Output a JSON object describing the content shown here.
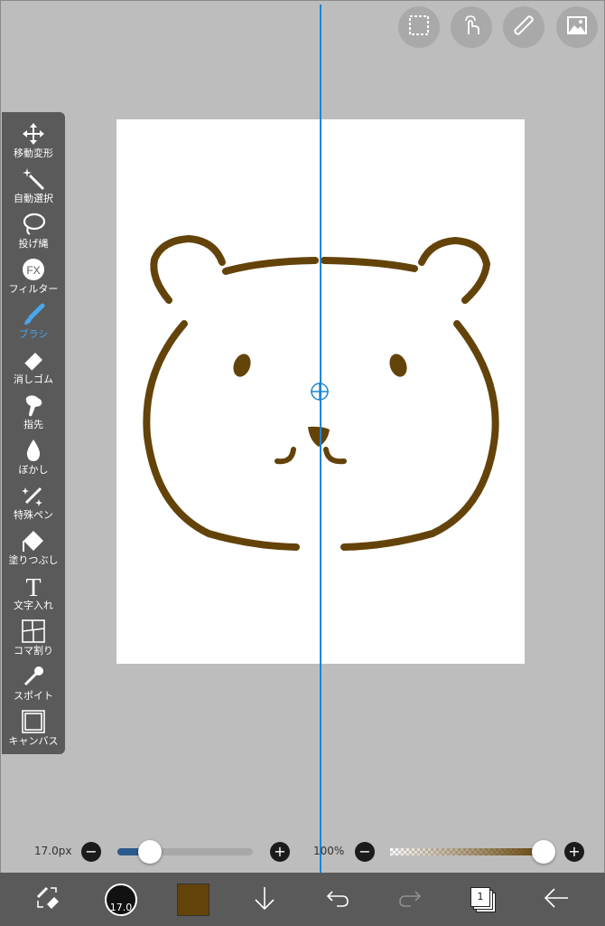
{
  "colors": {
    "accent": "#1a86d6",
    "brush_color": "#64430a",
    "toolbar_bg": "#5a5a5a",
    "workspace_bg": "#bdbdbd"
  },
  "top_buttons": [
    {
      "name": "selection-icon"
    },
    {
      "name": "hand-touch-icon"
    },
    {
      "name": "ruler-icon"
    },
    {
      "name": "image-icon"
    }
  ],
  "tools": [
    {
      "label": "移動変形",
      "icon": "move-transform-icon"
    },
    {
      "label": "自動選択",
      "icon": "magic-wand-icon"
    },
    {
      "label": "投げ縄",
      "icon": "lasso-icon"
    },
    {
      "label": "フィルター",
      "icon": "fx-filter-icon"
    },
    {
      "label": "ブラシ",
      "icon": "brush-icon",
      "active": true
    },
    {
      "label": "消しゴム",
      "icon": "eraser-icon"
    },
    {
      "label": "指先",
      "icon": "finger-smudge-icon"
    },
    {
      "label": "ぼかし",
      "icon": "blur-drop-icon"
    },
    {
      "label": "特殊ペン",
      "icon": "special-pen-icon"
    },
    {
      "label": "塗りつぶし",
      "icon": "bucket-fill-icon"
    },
    {
      "label": "文字入れ",
      "icon": "text-icon"
    },
    {
      "label": "コマ割り",
      "icon": "panel-divide-icon"
    },
    {
      "label": "スポイト",
      "icon": "eyedropper-icon"
    },
    {
      "label": "キャンバス",
      "icon": "canvas-icon"
    }
  ],
  "brush": {
    "size_text": "17.0px",
    "size_fraction": 0.24,
    "opacity_text": "100%",
    "opacity_fraction": 1.0,
    "size_badge": "17.0"
  },
  "layers": {
    "count": "1"
  }
}
